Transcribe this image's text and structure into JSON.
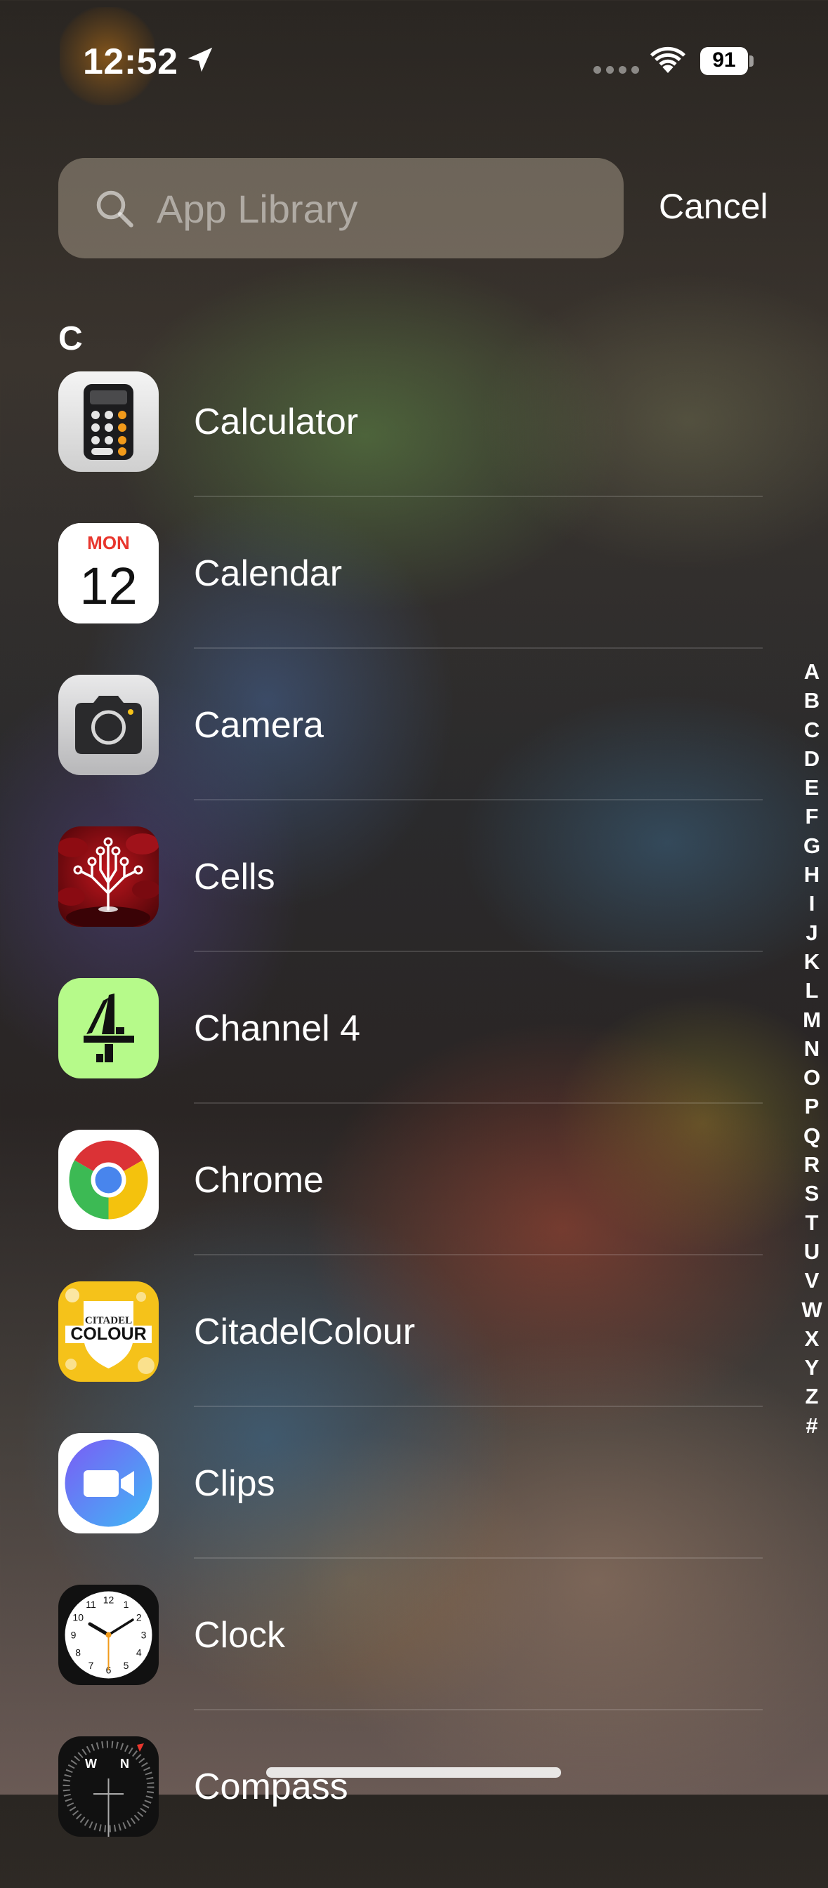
{
  "status_bar": {
    "time": "12:52",
    "battery": "91"
  },
  "search": {
    "placeholder": "App Library",
    "cancel_label": "Cancel"
  },
  "section": {
    "letter": "C"
  },
  "apps": [
    {
      "name": "Calculator",
      "icon": "calculator-icon"
    },
    {
      "name": "Calendar",
      "icon": "calendar-icon",
      "day": "MON",
      "date": "12"
    },
    {
      "name": "Camera",
      "icon": "camera-icon"
    },
    {
      "name": "Cells",
      "icon": "cells-icon"
    },
    {
      "name": "Channel 4",
      "icon": "channel-4-icon"
    },
    {
      "name": "Chrome",
      "icon": "chrome-icon"
    },
    {
      "name": "CitadelColour",
      "icon": "citadel-colour-icon",
      "logo_top": "CITADEL",
      "logo_bottom": "COLOUR"
    },
    {
      "name": "Clips",
      "icon": "clips-icon"
    },
    {
      "name": "Clock",
      "icon": "clock-icon",
      "dial": [
        "12",
        "1",
        "2",
        "3",
        "4",
        "5",
        "6",
        "7",
        "8",
        "9",
        "10",
        "11"
      ]
    },
    {
      "name": "Compass",
      "icon": "compass-icon",
      "dial": [
        "W",
        "N"
      ]
    }
  ],
  "alphabet_index": [
    "A",
    "B",
    "C",
    "D",
    "E",
    "F",
    "G",
    "H",
    "I",
    "J",
    "K",
    "L",
    "M",
    "N",
    "O",
    "P",
    "Q",
    "R",
    "S",
    "T",
    "U",
    "V",
    "W",
    "X",
    "Y",
    "Z",
    "#"
  ],
  "colors": {
    "calendar_red": "#e8362d",
    "channel4_green": "#b6fa8a",
    "citadel_yellow": "#f5c21a",
    "clips_gradient": [
      "#7b5cf5",
      "#3fb8f5"
    ],
    "calculator_orange": "#f19a1a"
  }
}
